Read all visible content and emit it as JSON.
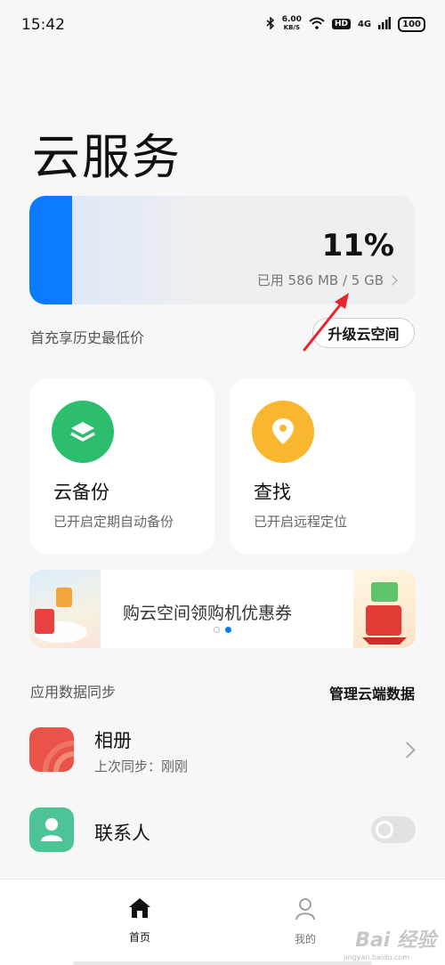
{
  "status_bar": {
    "time": "15:42",
    "net_speed_value": "6.00",
    "net_speed_unit": "KB/S",
    "hd_label": "HD",
    "network_label": "4G",
    "battery_level": "100"
  },
  "page_title": "云服务",
  "storage": {
    "used_fraction": 0.11,
    "percent_text": "11%",
    "detail_text": "已用 586 MB / 5 GB",
    "bar_color": "#0a7bff"
  },
  "promo": {
    "text": "首充享历史最低价",
    "upgrade_label": "升级云空间"
  },
  "features": [
    {
      "title": "云备份",
      "subtitle": "已开启定期自动备份",
      "icon": "layers-icon",
      "color": "#2dbd6e"
    },
    {
      "title": "查找",
      "subtitle": "已开启远程定位",
      "icon": "location-pin-icon",
      "color": "#f9b62f"
    }
  ],
  "banner": {
    "text": "购云空间领购机优惠券",
    "page_count": 2,
    "active_page": 2
  },
  "sync_section": {
    "label": "应用数据同步",
    "manage_label": "管理云端数据"
  },
  "sync_items": [
    {
      "title": "相册",
      "subtitle": "上次同步：刚刚",
      "icon": "gallery-icon",
      "color": "#e9534a",
      "control": "chevron"
    },
    {
      "title": "联系人",
      "icon": "contact-icon",
      "color": "#4cc496",
      "control": "toggle",
      "enabled": false
    }
  ],
  "bottom_nav": [
    {
      "label": "首页",
      "icon": "home-icon",
      "active": true
    },
    {
      "label": "我的",
      "icon": "user-icon",
      "active": false
    }
  ],
  "watermark": {
    "text": "Bai 经验",
    "sub": "jingyan.baidu.com"
  }
}
